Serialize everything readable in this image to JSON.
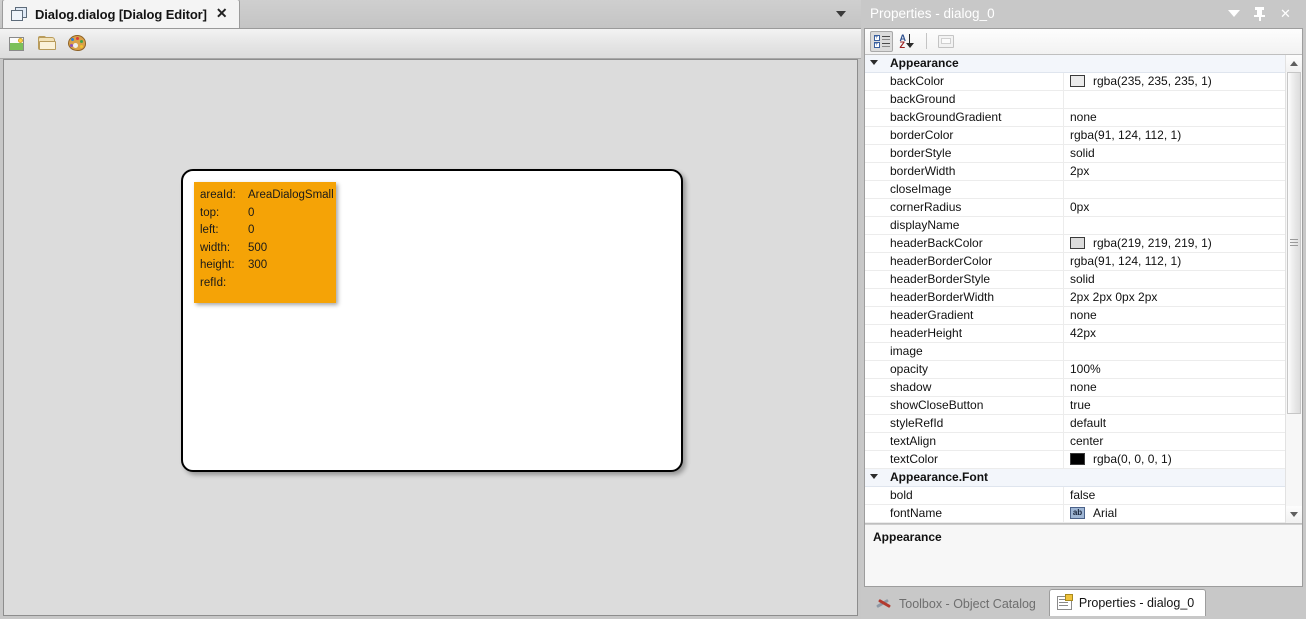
{
  "editor": {
    "tab": {
      "title": "Dialog.dialog [Dialog Editor]",
      "close_label": "✕",
      "icon": "document-stack-icon"
    },
    "tab_overflow": {
      "icon": "chevron-down-icon"
    },
    "toolbar": {
      "buttons": [
        {
          "name": "new-image-button",
          "icon": "new-image-icon",
          "label": ""
        },
        {
          "name": "open-folder-button",
          "icon": "open-folder-icon",
          "label": ""
        },
        {
          "name": "palette-button",
          "icon": "palette-icon",
          "label": ""
        }
      ]
    },
    "canvas": {
      "dialog_shape": {
        "name": "dialog-shape",
        "border_color": "#000000",
        "fill": "#ffffff"
      },
      "area_box": {
        "background": "#f5a306",
        "rows": [
          {
            "key": "areaId:",
            "value": "AreaDialogSmall"
          },
          {
            "key": "top:",
            "value": "0"
          },
          {
            "key": "left:",
            "value": "0"
          },
          {
            "key": "width:",
            "value": "500"
          },
          {
            "key": "height:",
            "value": "300"
          },
          {
            "key": "refId:",
            "value": ""
          }
        ]
      }
    }
  },
  "properties_panel": {
    "title": "Properties - dialog_0",
    "window_controls": [
      {
        "name": "panel-menu-button",
        "icon": "chevron-down-icon"
      },
      {
        "name": "panel-pin-button",
        "icon": "pin-icon"
      },
      {
        "name": "panel-close-button",
        "icon": "close-icon",
        "glyph": "✕"
      }
    ],
    "grid_toolbar": [
      {
        "name": "categorized-view-button",
        "icon": "categorized-icon",
        "pressed": true
      },
      {
        "name": "alphabetical-sort-button",
        "icon": "sort-az-icon",
        "pressed": false
      },
      {
        "name": "property-pages-button",
        "icon": "property-pages-icon",
        "pressed": false,
        "disabled": true
      }
    ],
    "rows": [
      {
        "type": "category",
        "name": "Appearance"
      },
      {
        "type": "property",
        "name": "backColor",
        "value": "rgba(235, 235, 235, 1)",
        "swatch": "#ebebeb"
      },
      {
        "type": "property",
        "name": "backGround",
        "value": ""
      },
      {
        "type": "property",
        "name": "backGroundGradient",
        "value": "none"
      },
      {
        "type": "property",
        "name": "borderColor",
        "value": "rgba(91, 124, 112, 1)"
      },
      {
        "type": "property",
        "name": "borderStyle",
        "value": "solid"
      },
      {
        "type": "property",
        "name": "borderWidth",
        "value": "2px"
      },
      {
        "type": "property",
        "name": "closeImage",
        "value": ""
      },
      {
        "type": "property",
        "name": "cornerRadius",
        "value": "0px"
      },
      {
        "type": "property",
        "name": "displayName",
        "value": ""
      },
      {
        "type": "property",
        "name": "headerBackColor",
        "value": "rgba(219, 219, 219, 1)",
        "swatch": "#dbdbdb"
      },
      {
        "type": "property",
        "name": "headerBorderColor",
        "value": "rgba(91, 124, 112, 1)"
      },
      {
        "type": "property",
        "name": "headerBorderStyle",
        "value": "solid"
      },
      {
        "type": "property",
        "name": "headerBorderWidth",
        "value": "2px 2px 0px 2px"
      },
      {
        "type": "property",
        "name": "headerGradient",
        "value": "none"
      },
      {
        "type": "property",
        "name": "headerHeight",
        "value": "42px"
      },
      {
        "type": "property",
        "name": "image",
        "value": ""
      },
      {
        "type": "property",
        "name": "opacity",
        "value": "100%"
      },
      {
        "type": "property",
        "name": "shadow",
        "value": "none"
      },
      {
        "type": "property",
        "name": "showCloseButton",
        "value": "true"
      },
      {
        "type": "property",
        "name": "styleRefId",
        "value": "default"
      },
      {
        "type": "property",
        "name": "textAlign",
        "value": "center"
      },
      {
        "type": "property",
        "name": "textColor",
        "value": "rgba(0, 0, 0, 1)",
        "swatch": "#000000"
      },
      {
        "type": "category",
        "name": "Appearance.Font"
      },
      {
        "type": "property",
        "name": "bold",
        "value": "false"
      },
      {
        "type": "property",
        "name": "fontName",
        "value": "Arial",
        "editor_icon": "ab"
      }
    ],
    "scrollbar": {
      "up_icon": "scroll-up-icon",
      "down_icon": "scroll-down-icon"
    },
    "description": "Appearance"
  },
  "bottom_tabs": [
    {
      "name": "tab-toolbox-object-catalog",
      "label": "Toolbox - Object Catalog",
      "icon": "toolbox-icon",
      "active": false
    },
    {
      "name": "tab-properties-dialog",
      "label": "Properties - dialog_0",
      "icon": "properties-icon",
      "active": true
    }
  ]
}
